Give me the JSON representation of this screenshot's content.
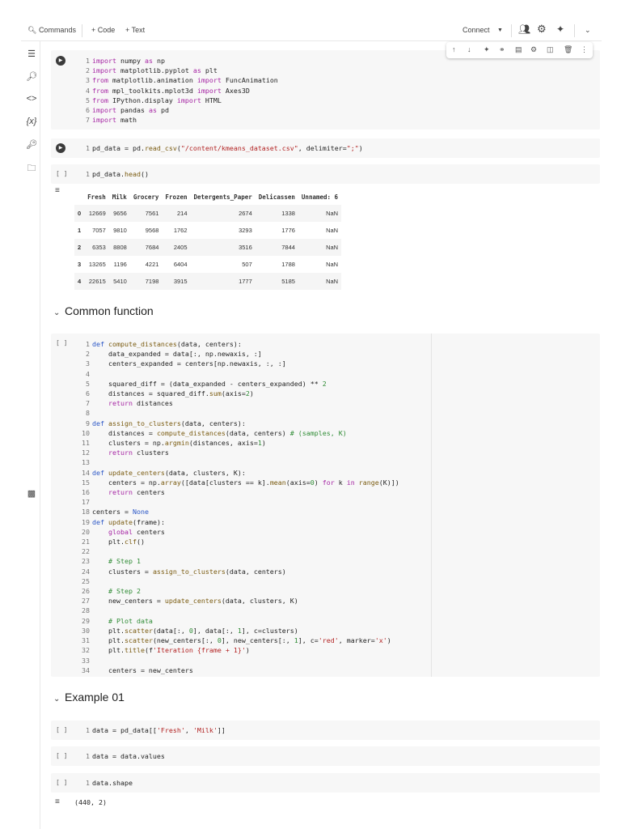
{
  "toolbar": {
    "commands": "Commands",
    "code": "+ Code",
    "text": "+ Text",
    "connect": "Connect"
  },
  "cells": [
    {
      "lines": [
        "import numpy as np",
        "import matplotlib.pyplot as plt",
        "from matplotlib.animation import FuncAnimation",
        "from mpl_toolkits.mplot3d import Axes3D",
        "from IPython.display import HTML",
        "import pandas as pd",
        "import math"
      ]
    },
    {
      "lines": [
        "pd_data = pd.read_csv(\"/content/kmeans_dataset.csv\", delimiter=\";\")"
      ]
    },
    {
      "lines": [
        "pd_data.head()"
      ]
    },
    {
      "lines": [
        "def compute_distances(data, centers):",
        "    data_expanded = data[:, np.newaxis, :]",
        "    centers_expanded = centers[np.newaxis, :, :]",
        "",
        "    squared_diff = (data_expanded - centers_expanded) ** 2",
        "    distances = squared_diff.sum(axis=2)",
        "    return distances",
        "",
        "def assign_to_clusters(data, centers):",
        "    distances = compute_distances(data, centers) # (samples, K)",
        "    clusters = np.argmin(distances, axis=1)",
        "    return clusters",
        "",
        "def update_centers(data, clusters, K):",
        "    centers = np.array([data[clusters == k].mean(axis=0) for k in range(K)])",
        "    return centers",
        "",
        "centers = None",
        "def update(frame):",
        "    global centers",
        "    plt.clf()",
        "",
        "    # Step 1",
        "    clusters = assign_to_clusters(data, centers)",
        "",
        "    # Step 2",
        "    new_centers = update_centers(data, clusters, K)",
        "",
        "    # Plot data",
        "    plt.scatter(data[:, 0], data[:, 1], c=clusters)",
        "    plt.scatter(new_centers[:, 0], new_centers[:, 1], c='red', marker='x')",
        "    plt.title(f'Iteration {frame + 1}')",
        "",
        "    centers = new_centers"
      ]
    },
    {
      "lines": [
        "data = pd_data[['Fresh', 'Milk']]"
      ]
    },
    {
      "lines": [
        "data = data.values"
      ]
    },
    {
      "lines": [
        "data.shape"
      ]
    }
  ],
  "table": {
    "columns": [
      "",
      "Fresh",
      "Milk",
      "Grocery",
      "Frozen",
      "Detergents_Paper",
      "Delicassen",
      "Unnamed: 6"
    ],
    "rows": [
      [
        "0",
        "12669",
        "9656",
        "7561",
        "214",
        "2674",
        "1338",
        "NaN"
      ],
      [
        "1",
        "7057",
        "9810",
        "9568",
        "1762",
        "3293",
        "1776",
        "NaN"
      ],
      [
        "2",
        "6353",
        "8808",
        "7684",
        "2405",
        "3516",
        "7844",
        "NaN"
      ],
      [
        "3",
        "13265",
        "1196",
        "4221",
        "6404",
        "507",
        "1788",
        "NaN"
      ],
      [
        "4",
        "22615",
        "5410",
        "7198",
        "3915",
        "1777",
        "5185",
        "NaN"
      ]
    ]
  },
  "sections": [
    "Common function",
    "Example 01"
  ],
  "shape_output": "(440, 2)",
  "run_marker": "[ ]"
}
